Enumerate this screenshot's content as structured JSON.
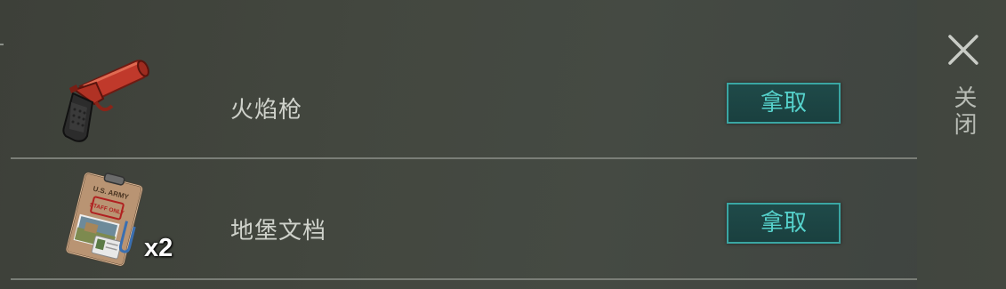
{
  "loot": {
    "items": [
      {
        "name": "火焰枪",
        "icon": "flare-gun-icon",
        "quantity": "",
        "button_label": "拿取"
      },
      {
        "name": "地堡文档",
        "icon": "bunker-document-icon",
        "quantity": "x2",
        "button_label": "拿取",
        "folder_text_top": "U.S. ARMY",
        "folder_stamp": "STAFF ONLY"
      }
    ]
  },
  "close": {
    "label": "关闭"
  },
  "colors": {
    "button_text": "#56d2cc",
    "button_border": "#3aa6a3",
    "button_bg": "#1f4a49",
    "item_text": "#cfd2cb",
    "divider": "#7a7e77"
  }
}
